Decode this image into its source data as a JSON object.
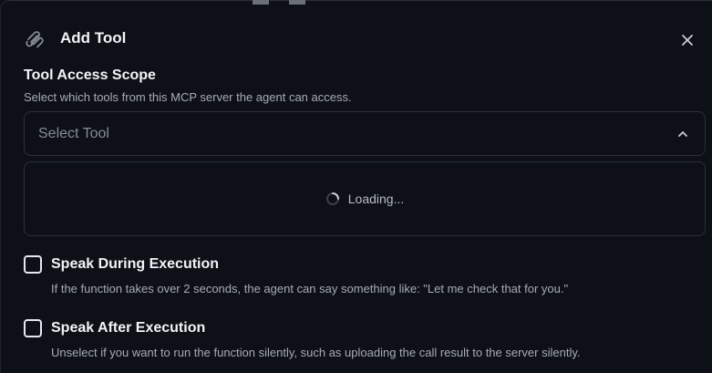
{
  "dialog": {
    "title": "Add Tool",
    "icon": "paperclip-icon",
    "close_icon": "close-icon"
  },
  "tool_access": {
    "title": "Tool Access Scope",
    "description": "Select which tools from this MCP server the agent can access.",
    "select_placeholder": "Select Tool",
    "loading_text": "Loading..."
  },
  "options": [
    {
      "label": "Speak During Execution",
      "description": "If the function takes over 2 seconds, the agent can say something like: \"Let me check that for you.\"",
      "checked": false
    },
    {
      "label": "Speak After Execution",
      "description": "Unselect if you want to run the function silently, such as uploading the call result to the server silently.",
      "checked": false
    }
  ]
}
